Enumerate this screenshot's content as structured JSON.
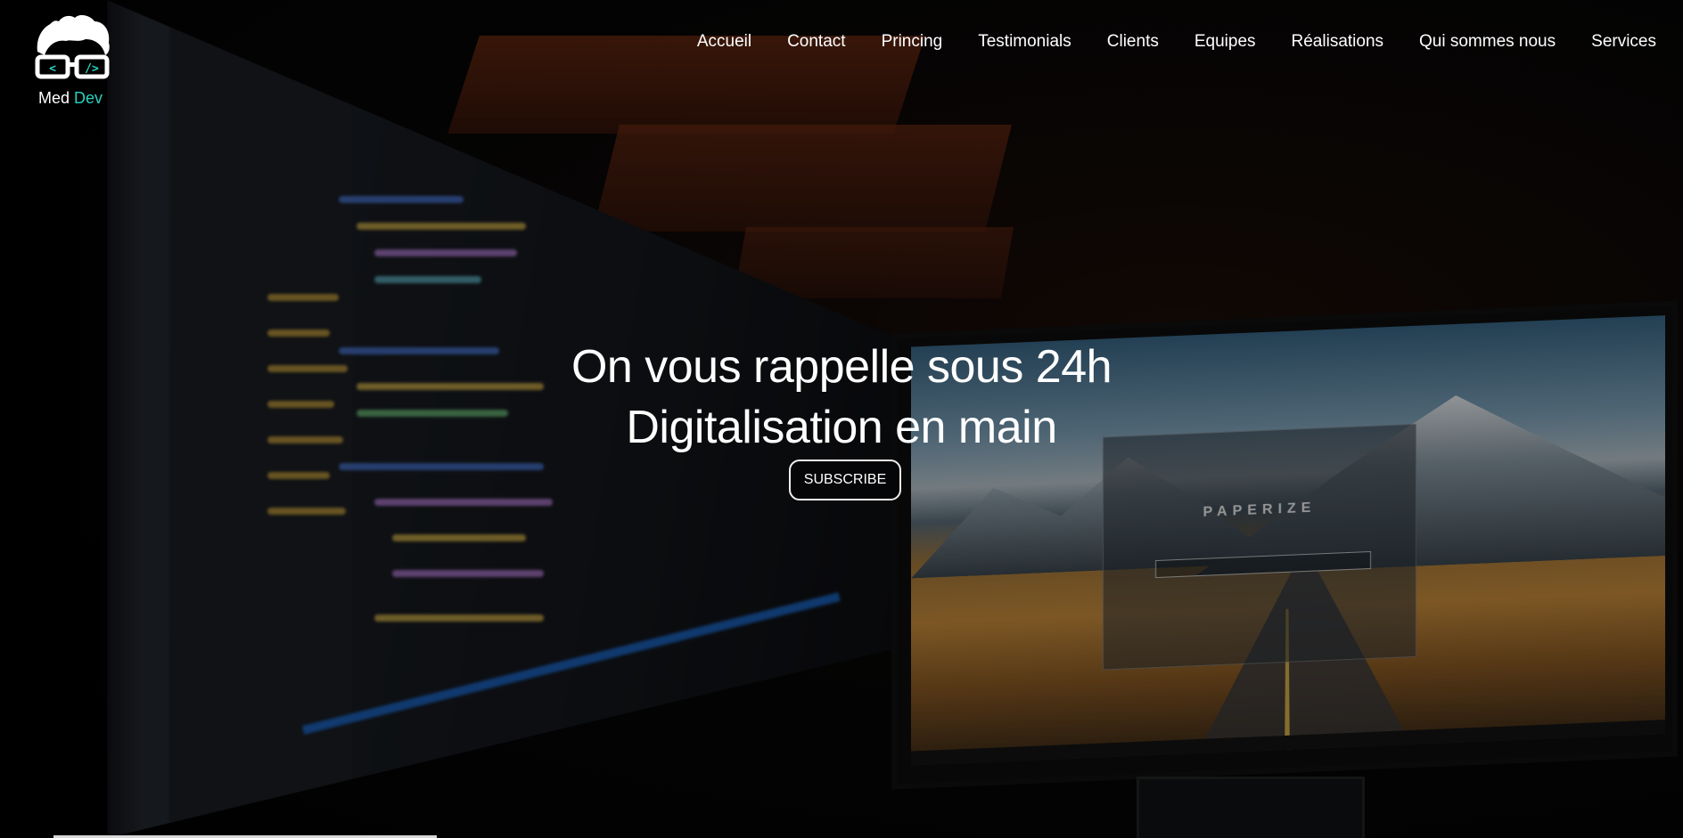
{
  "brand": {
    "name_part1": "Med",
    "name_part2": "Dev",
    "logo_icon": "hair-glasses-logo-icon",
    "accent_color": "#27d3c0"
  },
  "nav": {
    "items": [
      {
        "label": "Accueil"
      },
      {
        "label": "Contact"
      },
      {
        "label": "Princing"
      },
      {
        "label": "Testimonials"
      },
      {
        "label": "Clients"
      },
      {
        "label": "Equipes"
      },
      {
        "label": "Réalisations"
      },
      {
        "label": "Qui sommes nous"
      },
      {
        "label": "Services"
      }
    ]
  },
  "hero": {
    "line1": "On vous rappelle sous 24h",
    "line2": "Digitalisation en main",
    "cta_label": "SUBSCRIBE",
    "wallpaper_app_title": "PAPERIZE"
  }
}
